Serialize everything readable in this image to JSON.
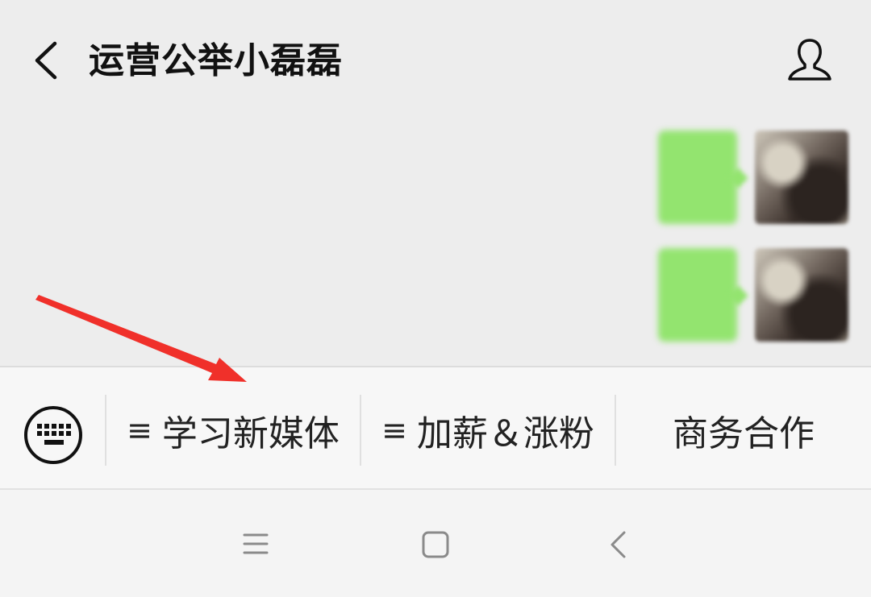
{
  "header": {
    "title": "运营公举小磊磊",
    "back_icon": "chevron-left-icon",
    "profile_icon": "user-profile-icon"
  },
  "chat": {
    "messages": [
      {
        "side": "right",
        "bubble_color": "#93e46f"
      },
      {
        "side": "right",
        "bubble_color": "#93e46f"
      }
    ]
  },
  "menu": {
    "keyboard_icon": "keyboard-icon",
    "items": [
      {
        "glyph": "≡",
        "label": "学习新媒体"
      },
      {
        "glyph": "≡",
        "label": "加薪＆涨粉"
      },
      {
        "glyph": "",
        "label": "商务合作"
      }
    ]
  },
  "annotation": {
    "arrow_color": "#f0302a"
  },
  "system_nav": {
    "buttons": [
      "menu-icon",
      "home-square-icon",
      "back-chevron-icon"
    ]
  }
}
